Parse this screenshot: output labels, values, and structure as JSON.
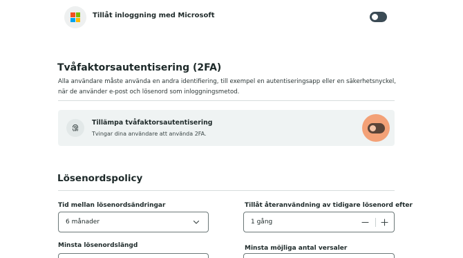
{
  "microsoft_login": {
    "label": "Tillåt inloggning med Microsoft",
    "enabled": false,
    "logo_colors": [
      "#f25022",
      "#7fba00",
      "#00a4ef",
      "#ffb900"
    ]
  },
  "two_factor": {
    "heading": "Tvåfaktorsautentisering (2FA)",
    "description": "Alla användare måste använda en andra identifiering, till exempel en autentiseringsapp eller en säkerhetsnyckel, när de använder e-post och lösenord som inloggningsmetod.",
    "enforce_title": "Tillämpa tvåfaktorsautentisering",
    "enforce_subtitle": "Tvingar dina användare att använda 2FA.",
    "enforce_enabled": false,
    "icon": "fingerprint-icon"
  },
  "password_policy": {
    "heading": "Lösenordspolicy",
    "change_interval": {
      "label": "Tid mellan lösenordsändringar",
      "value": "6 månader"
    },
    "reuse": {
      "label": "Tillåt återanvändning av tidigare lösenord efter",
      "value": "1 gång"
    },
    "min_length": {
      "label": "Minsta lösenordslängd"
    },
    "min_uppercase": {
      "label": "Minsta möjliga antal versaler"
    }
  },
  "colors": {
    "toggle_off": "#3b4b55",
    "focus_accent": "#f3a177",
    "card_background": "#eff3f3"
  }
}
